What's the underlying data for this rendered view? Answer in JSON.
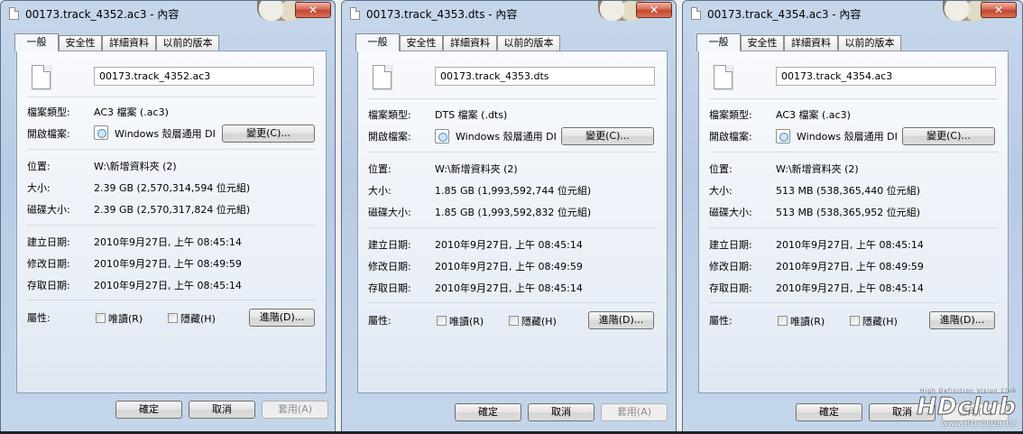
{
  "dialogs": [
    {
      "title": "00173.track_4352.ac3 - 內容",
      "close_label": "✕",
      "tabs": [
        "一般",
        "安全性",
        "詳細資料",
        "以前的版本"
      ],
      "file_name": "00173.track_4352.ac3",
      "file_type": {
        "label": "檔案類型:",
        "value": "AC3 檔案 (.ac3)"
      },
      "opens_with": {
        "label": "開啟檔案:",
        "app": "Windows 殼層通用 DI",
        "change_button": "變更(C)..."
      },
      "location": {
        "label": "位置:",
        "value": "W:\\新增資料夾 (2)"
      },
      "size": {
        "label": "大小:",
        "value": "2.39 GB (2,570,314,594 位元組)"
      },
      "size_on_disk": {
        "label": "磁碟大小:",
        "value": "2.39 GB (2,570,317,824 位元組)"
      },
      "created": {
        "label": "建立日期:",
        "value": "2010年9月27日, 上午 08:45:14"
      },
      "modified": {
        "label": "修改日期:",
        "value": "2010年9月27日, 上午 08:49:59"
      },
      "accessed": {
        "label": "存取日期:",
        "value": "2010年9月27日, 上午 08:45:14"
      },
      "attributes": {
        "label": "屬性:",
        "readonly": "唯讀(R)",
        "hidden": "隱藏(H)",
        "advanced_button": "進階(D)..."
      },
      "buttons": {
        "ok": "確定",
        "cancel": "取消",
        "apply": "套用(A)"
      }
    },
    {
      "title": "00173.track_4353.dts - 內容",
      "close_label": "✕",
      "tabs": [
        "一般",
        "安全性",
        "詳細資料",
        "以前的版本"
      ],
      "file_name": "00173.track_4353.dts",
      "file_type": {
        "label": "檔案類型:",
        "value": "DTS 檔案 (.dts)"
      },
      "opens_with": {
        "label": "開啟檔案:",
        "app": "Windows 殼層通用 DI",
        "change_button": "變更(C)..."
      },
      "location": {
        "label": "位置:",
        "value": "W:\\新增資料夾 (2)"
      },
      "size": {
        "label": "大小:",
        "value": "1.85 GB (1,993,592,744 位元組)"
      },
      "size_on_disk": {
        "label": "磁碟大小:",
        "value": "1.85 GB (1,993,592,832 位元組)"
      },
      "created": {
        "label": "建立日期:",
        "value": "2010年9月27日, 上午 08:45:14"
      },
      "modified": {
        "label": "修改日期:",
        "value": "2010年9月27日, 上午 08:49:59"
      },
      "accessed": {
        "label": "存取日期:",
        "value": "2010年9月27日, 上午 08:45:14"
      },
      "attributes": {
        "label": "屬性:",
        "readonly": "唯讀(R)",
        "hidden": "隱藏(H)",
        "advanced_button": "進階(D)..."
      },
      "buttons": {
        "ok": "確定",
        "cancel": "取消",
        "apply": "套用(A)"
      }
    },
    {
      "title": "00173.track_4354.ac3 - 內容",
      "close_label": "✕",
      "tabs": [
        "一般",
        "安全性",
        "詳細資料",
        "以前的版本"
      ],
      "file_name": "00173.track_4354.ac3",
      "file_type": {
        "label": "檔案類型:",
        "value": "AC3 檔案 (.ac3)"
      },
      "opens_with": {
        "label": "開啟檔案:",
        "app": "Windows 殼層通用 DI",
        "change_button": "變更(C)..."
      },
      "location": {
        "label": "位置:",
        "value": "W:\\新增資料夾 (2)"
      },
      "size": {
        "label": "大小:",
        "value": "513 MB (538,365,440 位元組)"
      },
      "size_on_disk": {
        "label": "磁碟大小:",
        "value": "513 MB (538,365,952 位元組)"
      },
      "created": {
        "label": "建立日期:",
        "value": "2010年9月27日, 上午 08:45:14"
      },
      "modified": {
        "label": "修改日期:",
        "value": "2010年9月27日, 上午 08:49:59"
      },
      "accessed": {
        "label": "存取日期:",
        "value": "2010年9月27日, 上午 08:45:14"
      },
      "attributes": {
        "label": "屬性:",
        "readonly": "唯讀(R)",
        "hidden": "隱藏(H)",
        "advanced_button": "進階(D)..."
      },
      "buttons": {
        "ok": "確定",
        "cancel": "取消",
        "apply": "套用(A)"
      }
    }
  ],
  "watermark": {
    "logo": "HDclub",
    "url": "www.HD.CLUB.tw",
    "tagline": "High Definition Vision Club"
  }
}
